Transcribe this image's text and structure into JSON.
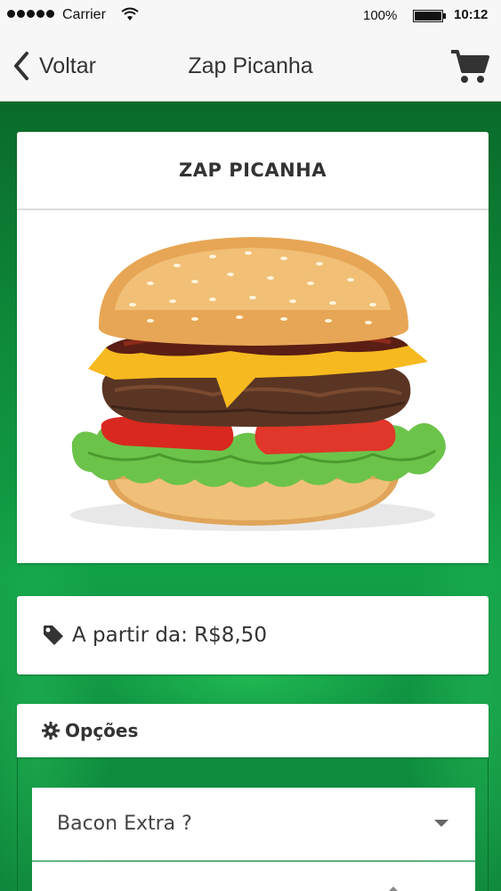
{
  "status_bar": {
    "carrier": "Carrier",
    "battery": "100%",
    "time": "10:12"
  },
  "nav": {
    "back_label": "Voltar",
    "title": "Zap Picanha",
    "cart_icon": "cart-icon"
  },
  "product": {
    "name": "ZAP PICANHA",
    "image": "burger-photo"
  },
  "price": {
    "icon": "tag-icon",
    "text": "A partir da: R$8,50"
  },
  "options": {
    "icon": "gear-icon",
    "title": "Opções",
    "selects": [
      {
        "label": "Bacon Extra ?"
      }
    ]
  },
  "colors": {
    "background_green": "#0f8a3c",
    "nav_bg": "#f7f7f7",
    "text": "#333333"
  }
}
